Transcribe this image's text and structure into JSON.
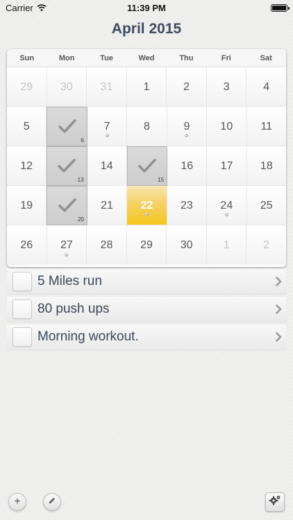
{
  "status_bar": {
    "carrier": "Carrier",
    "time": "11:39 PM"
  },
  "calendar": {
    "title": "April 2015",
    "weekdays": [
      "Sun",
      "Mon",
      "Tue",
      "Wed",
      "Thu",
      "Fri",
      "Sat"
    ],
    "weeks": [
      [
        {
          "label": "29",
          "other": true
        },
        {
          "label": "30",
          "other": true
        },
        {
          "label": "31",
          "other": true
        },
        {
          "label": "1"
        },
        {
          "label": "2"
        },
        {
          "label": "3"
        },
        {
          "label": "4"
        }
      ],
      [
        {
          "label": "5"
        },
        {
          "label": "",
          "done": true,
          "badge": "6"
        },
        {
          "label": "7",
          "dot": true
        },
        {
          "label": "8"
        },
        {
          "label": "9",
          "dot": true
        },
        {
          "label": "10"
        },
        {
          "label": "11"
        }
      ],
      [
        {
          "label": "12"
        },
        {
          "label": "",
          "done": true,
          "badge": "13"
        },
        {
          "label": "14"
        },
        {
          "label": "",
          "done": true,
          "badge": "15"
        },
        {
          "label": "16"
        },
        {
          "label": "17"
        },
        {
          "label": "18"
        }
      ],
      [
        {
          "label": "19"
        },
        {
          "label": "",
          "done": true,
          "badge": "20"
        },
        {
          "label": "21"
        },
        {
          "label": "22",
          "today": true,
          "dot": true
        },
        {
          "label": "23"
        },
        {
          "label": "24",
          "dot": true
        },
        {
          "label": "25"
        }
      ],
      [
        {
          "label": "26"
        },
        {
          "label": "27",
          "dot": true
        },
        {
          "label": "28"
        },
        {
          "label": "29"
        },
        {
          "label": "30"
        },
        {
          "label": "1",
          "other": true
        },
        {
          "label": "2",
          "other": true
        }
      ]
    ]
  },
  "tasks": [
    {
      "label": "5 Miles run"
    },
    {
      "label": "80 push ups"
    },
    {
      "label": "Morning workout."
    }
  ],
  "toolbar": {
    "add_label": "+",
    "add_icon": "plus-icon",
    "edit_icon": "pencil-icon",
    "settings_icon": "gear-icon"
  },
  "colors": {
    "title": "#3e4a5c",
    "today": "#f4c61c",
    "done_cell": "#d3d3d3"
  }
}
